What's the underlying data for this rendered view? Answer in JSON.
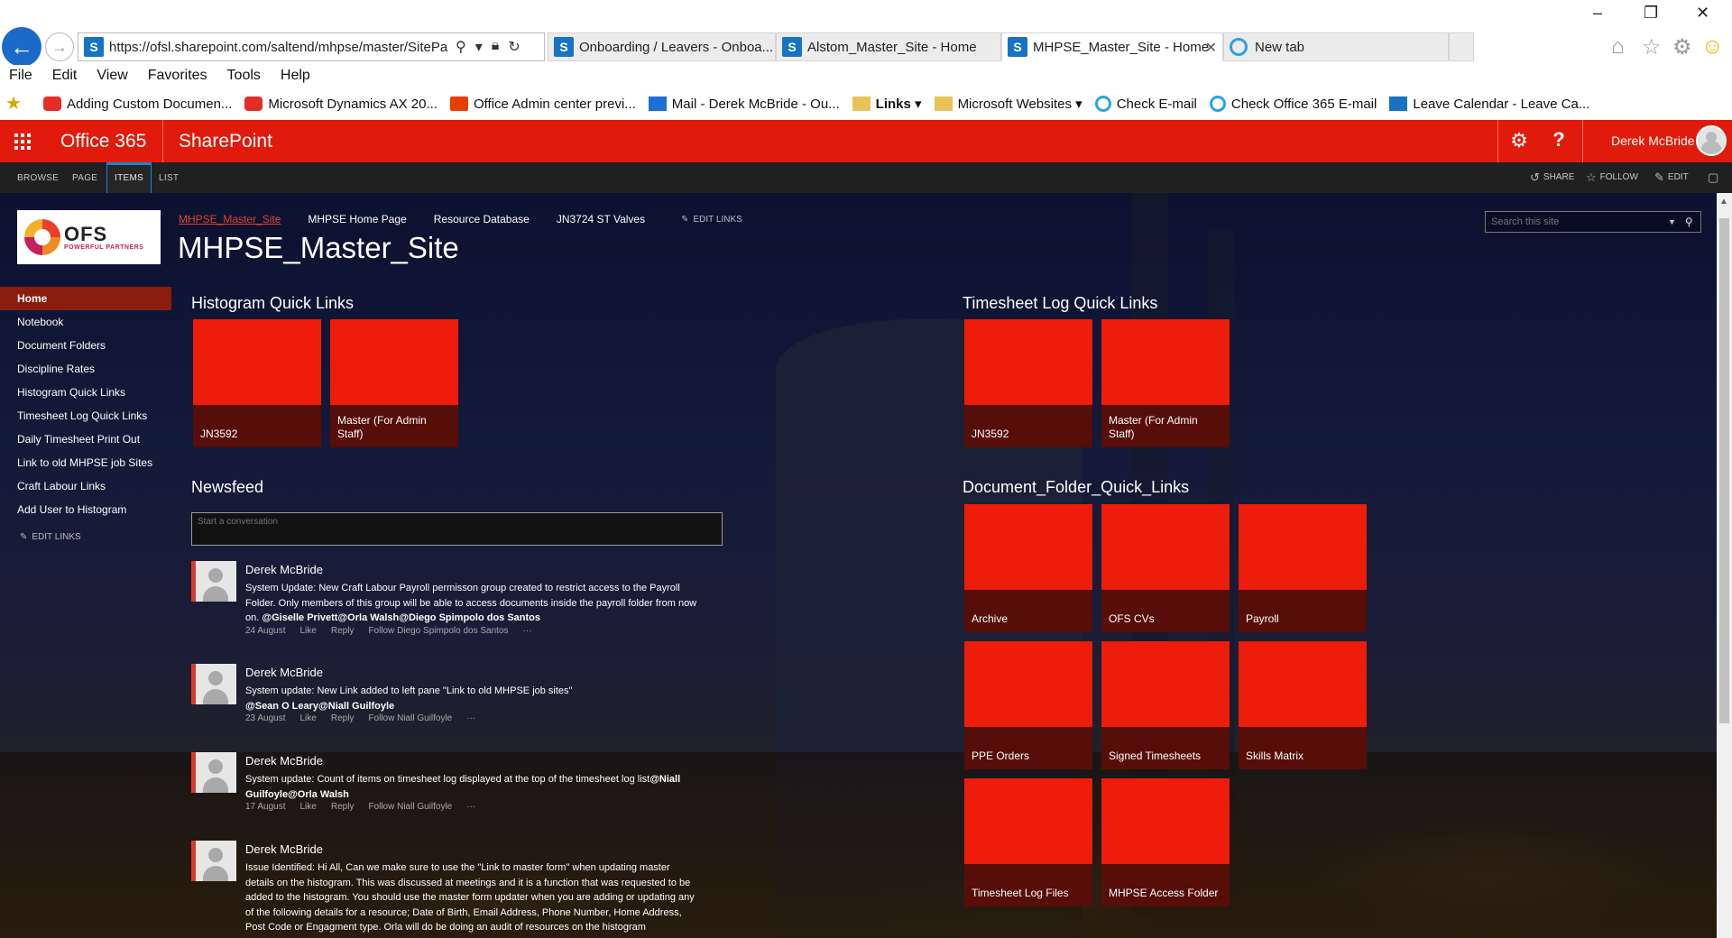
{
  "browser": {
    "address": "https://ofsl.sharepoint.com/saltend/mhpse/master/SitePa",
    "tabs": [
      {
        "label": "Onboarding / Leavers - Onboa..."
      },
      {
        "label": "Alstom_Master_Site - Home"
      },
      {
        "label": "MHPSE_Master_Site - Home"
      },
      {
        "label": "New tab"
      }
    ],
    "menu": [
      "File",
      "Edit",
      "View",
      "Favorites",
      "Tools",
      "Help"
    ],
    "favorites": [
      {
        "label": "Adding Custom Documen...",
        "icon": "youtube-icon"
      },
      {
        "label": "Microsoft Dynamics AX 20...",
        "icon": "youtube-icon"
      },
      {
        "label": "Office Admin center previ...",
        "icon": "office-icon"
      },
      {
        "label": "Mail - Derek McBride - Ou...",
        "icon": "mail-icon"
      },
      {
        "label": "Links",
        "icon": "folder-icon"
      },
      {
        "label": "Microsoft Websites",
        "icon": "folder-icon"
      },
      {
        "label": "Check E-mail",
        "icon": "ie-icon"
      },
      {
        "label": "Check Office 365 E-mail",
        "icon": "ie-icon"
      },
      {
        "label": "Leave Calendar - Leave Ca...",
        "icon": "sharepoint-icon"
      }
    ]
  },
  "suite": {
    "app": "Office 365",
    "product": "SharePoint",
    "user": "Derek McBride",
    "accent": "#e11b0b"
  },
  "ribbon": {
    "tabs": [
      "BROWSE",
      "PAGE",
      "ITEMS",
      "LIST"
    ],
    "active_tab": "ITEMS",
    "actions": {
      "share": "SHARE",
      "follow": "FOLLOW",
      "edit": "EDIT"
    }
  },
  "site": {
    "logo_text": "OFS",
    "logo_tagline": "POWERFUL PARTNERS",
    "top_nav": [
      "MHPSE_Master_Site",
      "MHPSE Home Page",
      "Resource Database",
      "JN3724 ST Valves"
    ],
    "edit_links": "EDIT LINKS",
    "title": "MHPSE_Master_Site",
    "search_placeholder": "Search this site"
  },
  "left_nav": {
    "items": [
      "Home",
      "Notebook",
      "Document Folders",
      "Discipline Rates",
      "Histogram Quick Links",
      "Timesheet Log Quick Links",
      "Daily Timesheet Print Out",
      "Link to old MHPSE job Sites",
      "Craft Labour Links",
      "Add User to Histogram"
    ],
    "active": "Home",
    "edit_links": "EDIT LINKS"
  },
  "sections": {
    "histogram": {
      "title": "Histogram Quick Links",
      "tiles": [
        "JN3592",
        "Master (For Admin Staff)"
      ]
    },
    "timesheet": {
      "title": "Timesheet Log Quick Links",
      "tiles": [
        "JN3592",
        "Master (For Admin Staff)"
      ]
    },
    "newsfeed": {
      "title": "Newsfeed",
      "placeholder": "Start a conversation"
    },
    "doc_folders": {
      "title": "Document_Folder_Quick_Links",
      "tiles": [
        "Archive",
        "OFS CVs",
        "Payroll",
        "PPE Orders",
        "Signed Timesheets",
        "Skills Matrix",
        "Timesheet Log Files",
        "MHPSE Access Folder"
      ]
    }
  },
  "posts": [
    {
      "author": "Derek McBride",
      "text": "System Update: New Craft Labour Payroll permisson group created to restrict access to the Payroll Folder. Only members of this group will be able to access documents inside the payroll folder from now on. ",
      "mentions": "@Giselle Privett@Orla Walsh@Diego Spimpolo dos Santos",
      "date": "24 August",
      "like": "Like",
      "reply": "Reply",
      "follow": "Follow Diego Spimpolo dos Santos",
      "more": "···"
    },
    {
      "author": "Derek McBride",
      "text": "System update: New Link added to left pane \"Link to old MHPSE job sites\"",
      "mentions": "@Sean O Leary@Niall Guilfoyle",
      "date": "23 August",
      "like": "Like",
      "reply": "Reply",
      "follow": "Follow Niall Guilfoyle",
      "more": "···"
    },
    {
      "author": "Derek McBride",
      "text": "System update: Count of items on timesheet log  displayed at the top of the timesheet log list",
      "mentions": "@Niall Guilfoyle@Orla Walsh",
      "date": "17 August",
      "like": "Like",
      "reply": "Reply",
      "follow": "Follow Niall Guilfoyle",
      "more": "···"
    },
    {
      "author": "Derek McBride",
      "text": "Issue Identified: Hi All, Can we make sure to use the \"Link to master form\" when updating master details on the histogram. This was discussed at meetings and it is a function that was requested to be added to the histogram. You should use the master form updater when you are adding or updating any of the following details for a resource; Date of Birth, Email Address, Phone Number, Home Address, Post Code or Engagment type. Orla will do be doing an audit of resources on the histogram",
      "mentions": "",
      "date": "",
      "like": "",
      "reply": "",
      "follow": "",
      "more": ""
    }
  ]
}
